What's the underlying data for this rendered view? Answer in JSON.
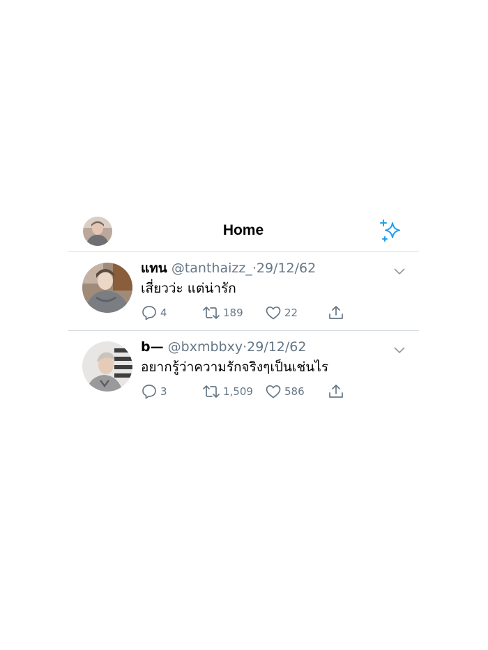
{
  "header": {
    "title": "Home",
    "icons": {
      "left": "profile-avatar",
      "right": "sparkle-icon"
    },
    "accent_color": "#1da1f2"
  },
  "tweets": [
    {
      "name": "แทน",
      "handle": "@tanthaizz_",
      "separator": "·",
      "date": "29/12/62",
      "text": "เสี่ยวว่ะ แต่น่ารัก",
      "replies": "4",
      "retweets": "189",
      "likes": "22"
    },
    {
      "name": "b—",
      "handle": "@bxmbbxy",
      "separator": "·",
      "date": "29/12/62",
      "text": "อยากรู้ว่าความรักจริงๆเป็นเช่นไร",
      "replies": "3",
      "retweets": "1,509",
      "likes": "586"
    }
  ]
}
